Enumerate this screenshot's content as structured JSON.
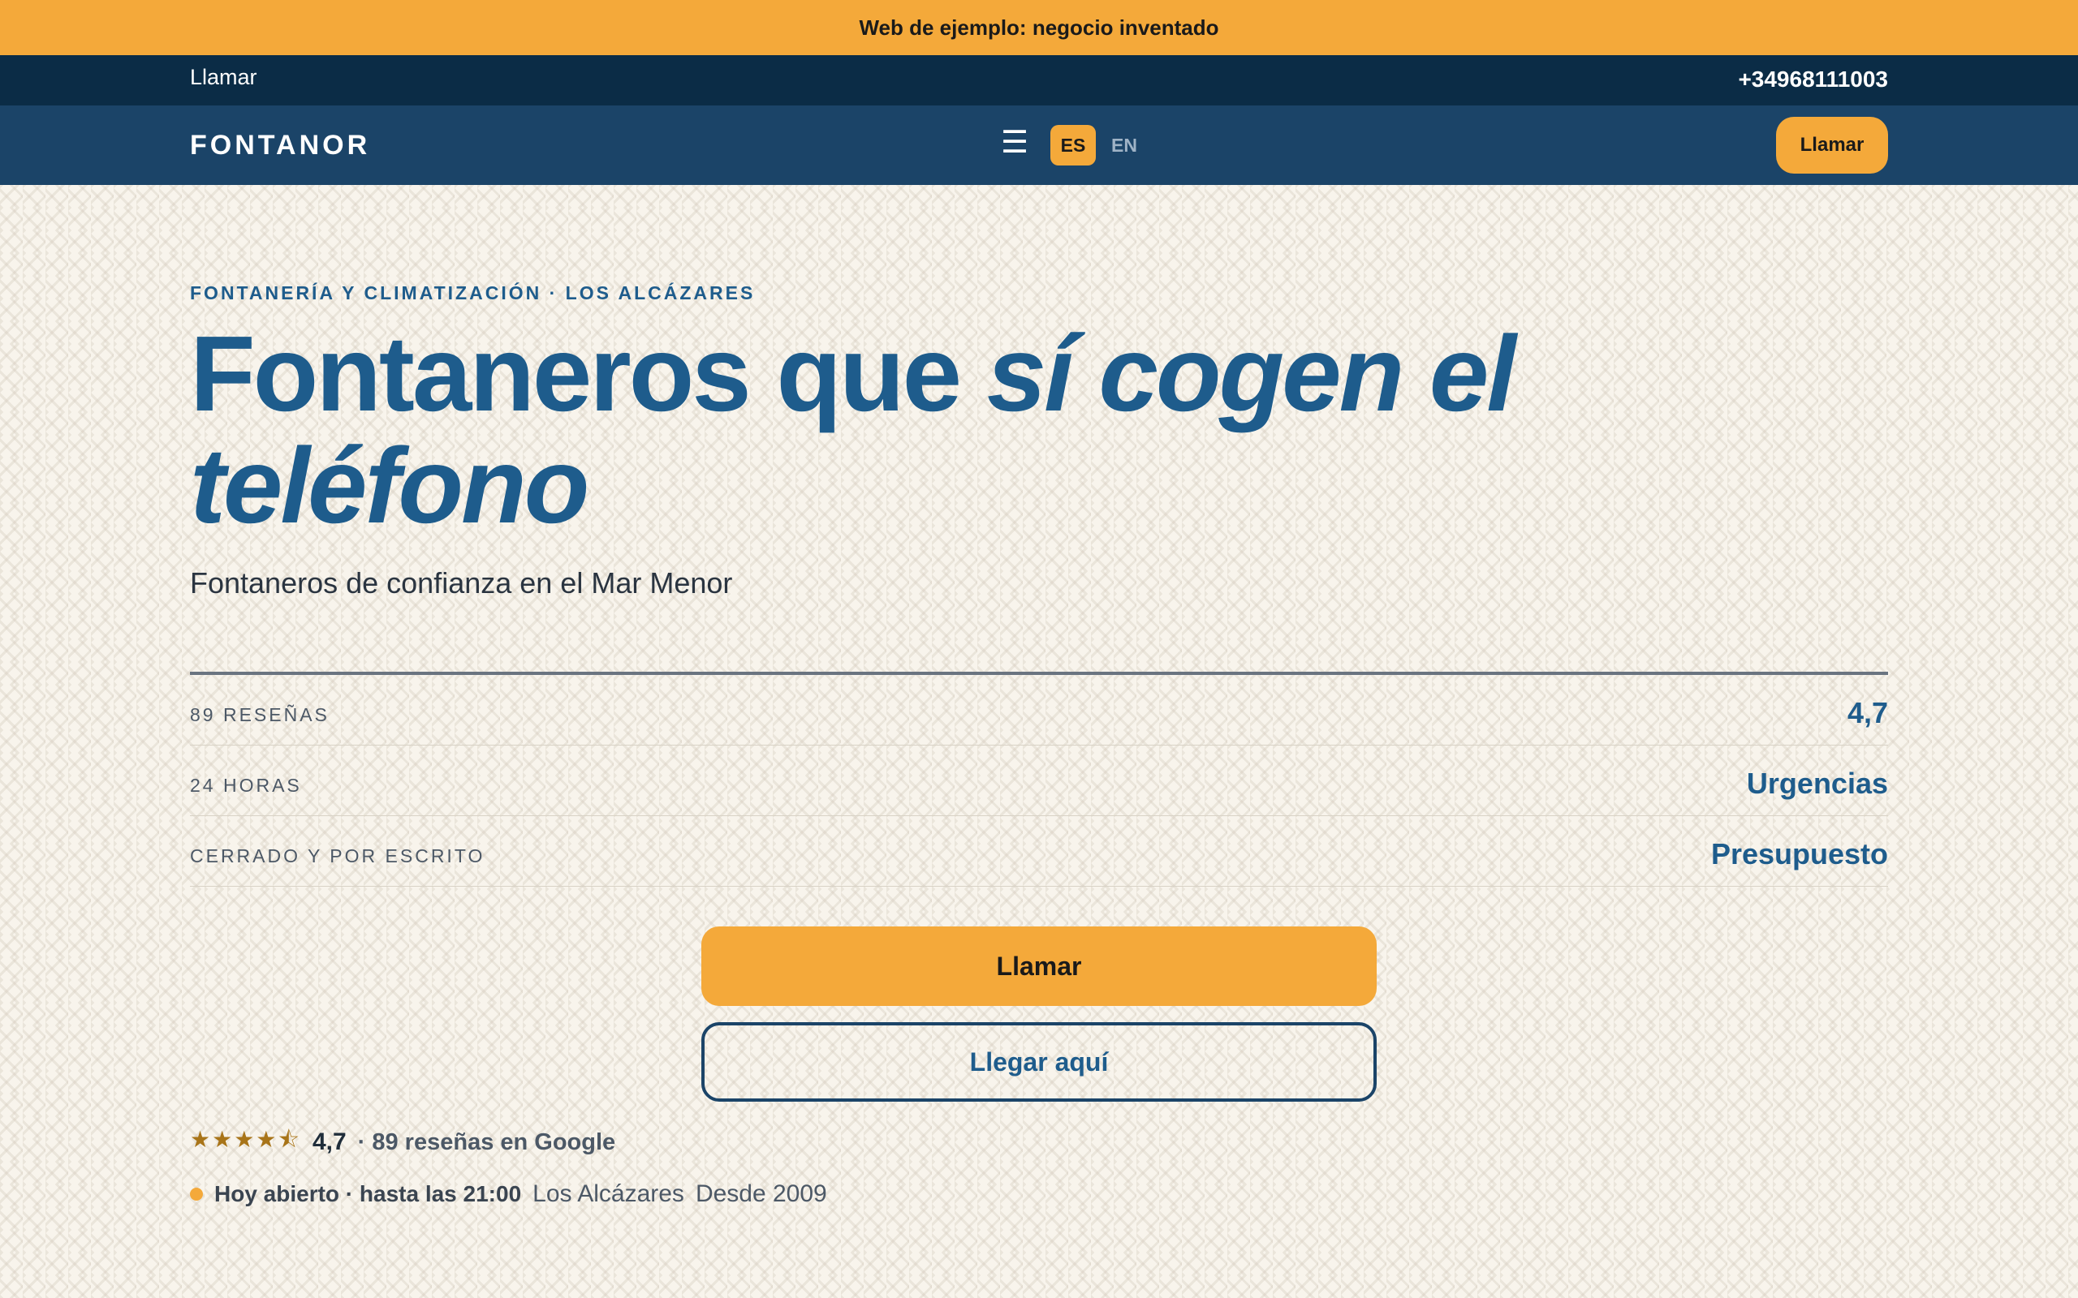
{
  "banner": {
    "text": "Web de ejemplo: negocio inventado"
  },
  "callbar": {
    "left_label": "Llamar",
    "phone": "+34968111003"
  },
  "nav": {
    "logo": "FONTANOR",
    "menu_icon": "hamburger-icon",
    "lang_es": "ES",
    "lang_en": "EN",
    "call_button": "Llamar"
  },
  "hero": {
    "eyebrow": "FONTANERÍA Y CLIMATIZACIÓN · LOS ALCÁZARES",
    "headline_plain": "Fontaneros que ",
    "headline_italic_1": "sí cogen el",
    "headline_italic_2": "teléfono",
    "subtitle": "Fontaneros de confianza en el Mar Menor"
  },
  "stats": [
    {
      "label": "89 RESEÑAS",
      "value": "4,7"
    },
    {
      "label": "24 HORAS",
      "value": "Urgencias"
    },
    {
      "label": "CERRADO Y POR ESCRITO",
      "value": "Presupuesto"
    }
  ],
  "actions": {
    "primary": "Llamar",
    "secondary": "Llegar aquí"
  },
  "rating": {
    "stars": "★★★★⯪",
    "value": "4,7",
    "text": "· 89 reseñas en Google"
  },
  "status": {
    "open": "Hoy abierto · hasta las 21:00",
    "place": "Los Alcázares",
    "since": "Desde 2009"
  },
  "colors": {
    "accent": "#f4a93a",
    "navy": "#0b2c46",
    "nav": "#1b4468",
    "brand_blue": "#1e5c8c",
    "background": "#f8f4ec"
  }
}
